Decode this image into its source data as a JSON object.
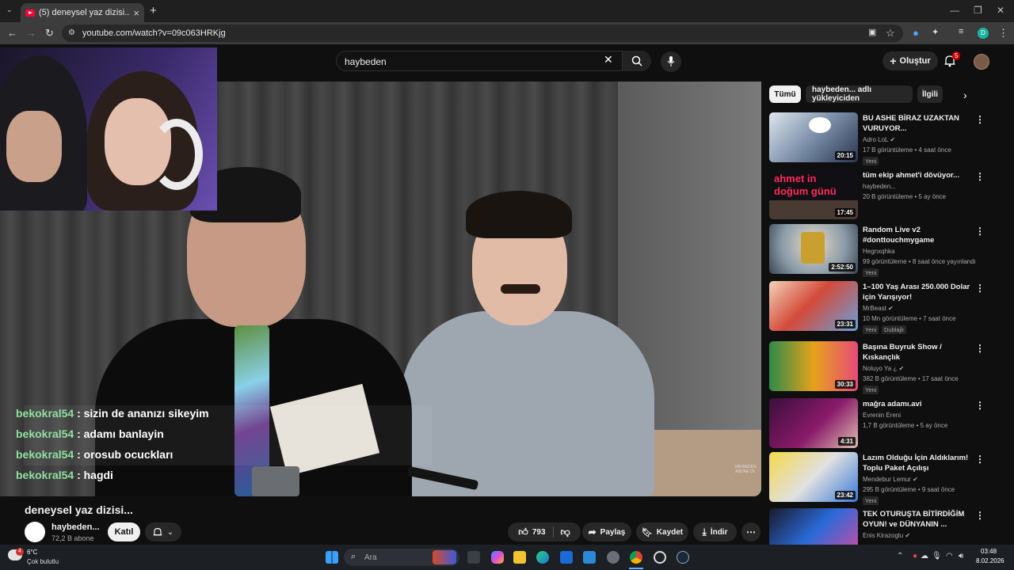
{
  "browser": {
    "tab_title": "(5) deneysel yaz dizisi... - YouTube",
    "url": "youtube.com/watch?v=09c063HRKjg"
  },
  "header": {
    "search_value": "haybeden",
    "create_label": "Oluştur",
    "notification_count": "5"
  },
  "chat": [
    {
      "user": "bekokral54",
      "message": ": sizin de ananızı sikeyim"
    },
    {
      "user": "bekokral54",
      "message": ": adamı banlayin"
    },
    {
      "user": "bekokral54",
      "message": ": orosub ocuckları"
    },
    {
      "user": "bekokral54",
      "message": ": hagdi"
    }
  ],
  "video": {
    "title": "deneysel yaz dizisi...",
    "watermark": "HAYBEDEN ABONE OL",
    "channel_name": "haybeden...",
    "subscribers": "72,2 B abone",
    "join_label": "Katıl",
    "like_count": "793",
    "share_label": "Paylaş",
    "save_label": "Kaydet",
    "download_label": "İndir"
  },
  "chips": [
    "Tümü",
    "haybeden... adlı yükleyiciden",
    "İlgili"
  ],
  "recommendations": [
    {
      "title": "BU ASHE BİRAZ UZAKTAN VURUYOR...",
      "channel": "Adro LoL",
      "meta": "17 B görüntüleme • 4 saat önce",
      "badge": "Yeni",
      "duration": "20:15",
      "verified": true
    },
    {
      "title": "tüm ekip ahmet'i dövüyor...",
      "channel": "haybeden...",
      "meta": "20 B görüntüleme • 5 ay önce",
      "badge": "",
      "duration": "17:45",
      "thumb_text": [
        "ahmet in",
        "doğum günü"
      ],
      "verified": false
    },
    {
      "title": "Random Live v2 #donttouchmygame",
      "channel": "Hegnxqhka",
      "meta": "99 görüntüleme • 8 saat önce yayınlandı",
      "badge": "Yeni",
      "duration": "2:52:50",
      "verified": false
    },
    {
      "title": "1–100 Yaş Arası 250.000 Dolar için Yarışıyor!",
      "channel": "MrBeast",
      "meta": "10 Mn görüntüleme • 7 saat önce",
      "badge": "Yeni",
      "badge2": "Dublajlı",
      "duration": "23:31",
      "verified": true
    },
    {
      "title": "Başına Buyruk Show / Kıskançlık",
      "channel": "Noluyo Ya ¿",
      "meta": "382 B görüntüleme • 17 saat önce",
      "badge": "Yeni",
      "duration": "30:33",
      "verified": true
    },
    {
      "title": "mağra adamı.avi",
      "channel": "Evrenin Ereni",
      "meta": "1,7 B görüntüleme • 5 ay önce",
      "badge": "",
      "duration": "4:31",
      "verified": false
    },
    {
      "title": "Lazım Olduğu İçin Aldıklarım! Toplu Paket Açılışı",
      "channel": "Mendebur Lemur",
      "meta": "295 B görüntüleme • 9 saat önce",
      "badge": "Yeni",
      "duration": "23:42",
      "verified": true
    },
    {
      "title": "TEK OTURUŞTA BİTİRDİĞİM OYUN! ve DÜNYANIN ...",
      "channel": "Enis Kirazoglu",
      "meta": "",
      "badge": "",
      "duration": "",
      "verified": true
    }
  ],
  "taskbar": {
    "temperature": "6°C",
    "weather": "Çok bulutlu",
    "weather_badge": "4",
    "search_placeholder": "Ara",
    "time": "03:48",
    "date": "8.02.2026"
  },
  "colors": {
    "youtube_red": "#ff0033",
    "chat_username": "#8fe0a0",
    "background": "#0f0f0f"
  }
}
